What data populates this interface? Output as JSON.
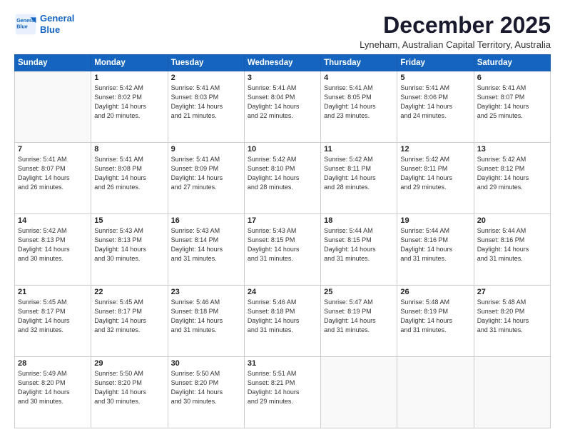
{
  "logo": {
    "line1": "General",
    "line2": "Blue"
  },
  "title": "December 2025",
  "subtitle": "Lyneham, Australian Capital Territory, Australia",
  "weekdays": [
    "Sunday",
    "Monday",
    "Tuesday",
    "Wednesday",
    "Thursday",
    "Friday",
    "Saturday"
  ],
  "weeks": [
    [
      {
        "day": "",
        "info": ""
      },
      {
        "day": "1",
        "info": "Sunrise: 5:42 AM\nSunset: 8:02 PM\nDaylight: 14 hours\nand 20 minutes."
      },
      {
        "day": "2",
        "info": "Sunrise: 5:41 AM\nSunset: 8:03 PM\nDaylight: 14 hours\nand 21 minutes."
      },
      {
        "day": "3",
        "info": "Sunrise: 5:41 AM\nSunset: 8:04 PM\nDaylight: 14 hours\nand 22 minutes."
      },
      {
        "day": "4",
        "info": "Sunrise: 5:41 AM\nSunset: 8:05 PM\nDaylight: 14 hours\nand 23 minutes."
      },
      {
        "day": "5",
        "info": "Sunrise: 5:41 AM\nSunset: 8:06 PM\nDaylight: 14 hours\nand 24 minutes."
      },
      {
        "day": "6",
        "info": "Sunrise: 5:41 AM\nSunset: 8:07 PM\nDaylight: 14 hours\nand 25 minutes."
      }
    ],
    [
      {
        "day": "7",
        "info": "Sunrise: 5:41 AM\nSunset: 8:07 PM\nDaylight: 14 hours\nand 26 minutes."
      },
      {
        "day": "8",
        "info": "Sunrise: 5:41 AM\nSunset: 8:08 PM\nDaylight: 14 hours\nand 26 minutes."
      },
      {
        "day": "9",
        "info": "Sunrise: 5:41 AM\nSunset: 8:09 PM\nDaylight: 14 hours\nand 27 minutes."
      },
      {
        "day": "10",
        "info": "Sunrise: 5:42 AM\nSunset: 8:10 PM\nDaylight: 14 hours\nand 28 minutes."
      },
      {
        "day": "11",
        "info": "Sunrise: 5:42 AM\nSunset: 8:11 PM\nDaylight: 14 hours\nand 28 minutes."
      },
      {
        "day": "12",
        "info": "Sunrise: 5:42 AM\nSunset: 8:11 PM\nDaylight: 14 hours\nand 29 minutes."
      },
      {
        "day": "13",
        "info": "Sunrise: 5:42 AM\nSunset: 8:12 PM\nDaylight: 14 hours\nand 29 minutes."
      }
    ],
    [
      {
        "day": "14",
        "info": "Sunrise: 5:42 AM\nSunset: 8:13 PM\nDaylight: 14 hours\nand 30 minutes."
      },
      {
        "day": "15",
        "info": "Sunrise: 5:43 AM\nSunset: 8:13 PM\nDaylight: 14 hours\nand 30 minutes."
      },
      {
        "day": "16",
        "info": "Sunrise: 5:43 AM\nSunset: 8:14 PM\nDaylight: 14 hours\nand 31 minutes."
      },
      {
        "day": "17",
        "info": "Sunrise: 5:43 AM\nSunset: 8:15 PM\nDaylight: 14 hours\nand 31 minutes."
      },
      {
        "day": "18",
        "info": "Sunrise: 5:44 AM\nSunset: 8:15 PM\nDaylight: 14 hours\nand 31 minutes."
      },
      {
        "day": "19",
        "info": "Sunrise: 5:44 AM\nSunset: 8:16 PM\nDaylight: 14 hours\nand 31 minutes."
      },
      {
        "day": "20",
        "info": "Sunrise: 5:44 AM\nSunset: 8:16 PM\nDaylight: 14 hours\nand 31 minutes."
      }
    ],
    [
      {
        "day": "21",
        "info": "Sunrise: 5:45 AM\nSunset: 8:17 PM\nDaylight: 14 hours\nand 32 minutes."
      },
      {
        "day": "22",
        "info": "Sunrise: 5:45 AM\nSunset: 8:17 PM\nDaylight: 14 hours\nand 32 minutes."
      },
      {
        "day": "23",
        "info": "Sunrise: 5:46 AM\nSunset: 8:18 PM\nDaylight: 14 hours\nand 31 minutes."
      },
      {
        "day": "24",
        "info": "Sunrise: 5:46 AM\nSunset: 8:18 PM\nDaylight: 14 hours\nand 31 minutes."
      },
      {
        "day": "25",
        "info": "Sunrise: 5:47 AM\nSunset: 8:19 PM\nDaylight: 14 hours\nand 31 minutes."
      },
      {
        "day": "26",
        "info": "Sunrise: 5:48 AM\nSunset: 8:19 PM\nDaylight: 14 hours\nand 31 minutes."
      },
      {
        "day": "27",
        "info": "Sunrise: 5:48 AM\nSunset: 8:20 PM\nDaylight: 14 hours\nand 31 minutes."
      }
    ],
    [
      {
        "day": "28",
        "info": "Sunrise: 5:49 AM\nSunset: 8:20 PM\nDaylight: 14 hours\nand 30 minutes."
      },
      {
        "day": "29",
        "info": "Sunrise: 5:50 AM\nSunset: 8:20 PM\nDaylight: 14 hours\nand 30 minutes."
      },
      {
        "day": "30",
        "info": "Sunrise: 5:50 AM\nSunset: 8:20 PM\nDaylight: 14 hours\nand 30 minutes."
      },
      {
        "day": "31",
        "info": "Sunrise: 5:51 AM\nSunset: 8:21 PM\nDaylight: 14 hours\nand 29 minutes."
      },
      {
        "day": "",
        "info": ""
      },
      {
        "day": "",
        "info": ""
      },
      {
        "day": "",
        "info": ""
      }
    ]
  ]
}
